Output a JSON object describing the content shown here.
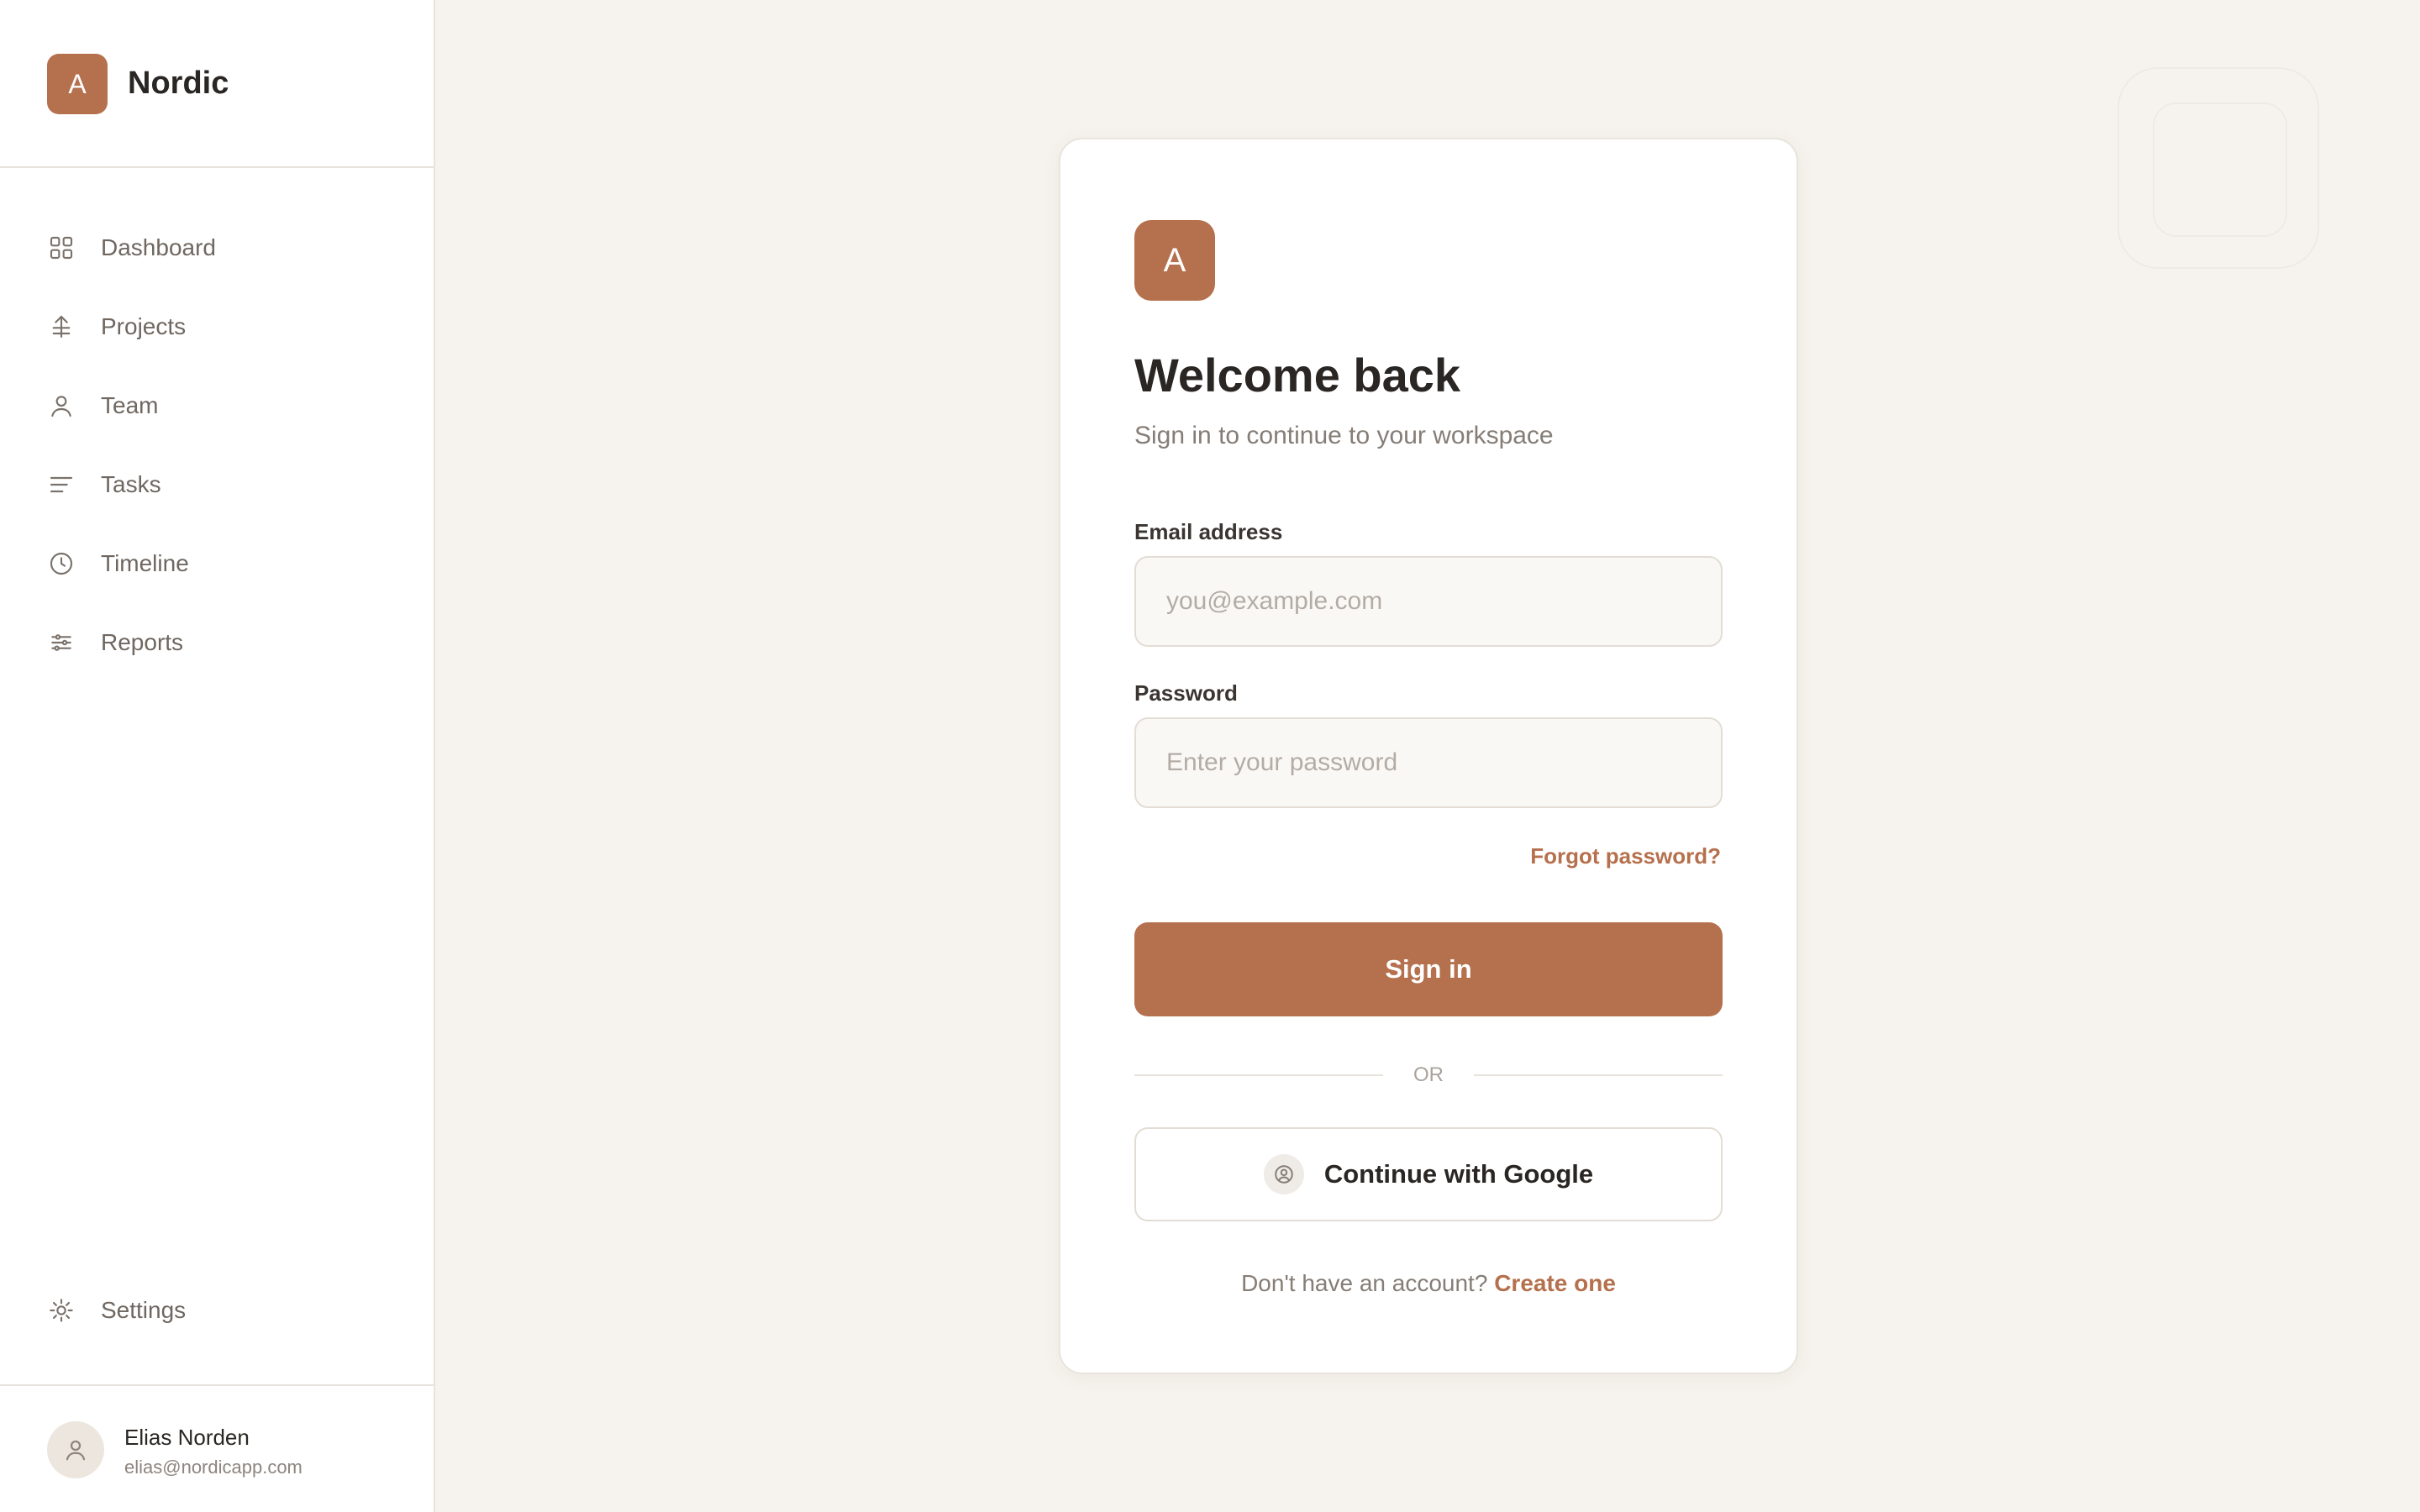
{
  "brand": {
    "logo_letter": "A",
    "name": "Nordic"
  },
  "sidebar": {
    "items": [
      {
        "label": "Dashboard",
        "icon": "grid-icon"
      },
      {
        "label": "Projects",
        "icon": "projects-icon"
      },
      {
        "label": "Team",
        "icon": "user-icon"
      },
      {
        "label": "Tasks",
        "icon": "list-icon"
      },
      {
        "label": "Timeline",
        "icon": "clock-icon"
      },
      {
        "label": "Reports",
        "icon": "sliders-icon"
      }
    ],
    "settings": {
      "label": "Settings",
      "icon": "gear-icon"
    }
  },
  "user": {
    "name": "Elias Norden",
    "email": "elias@nordicapp.com"
  },
  "login": {
    "logo_letter": "A",
    "title": "Welcome back",
    "subtitle": "Sign in to continue to your workspace",
    "email_label": "Email address",
    "email_placeholder": "you@example.com",
    "password_label": "Password",
    "password_placeholder": "Enter your password",
    "forgot_label": "Forgot password?",
    "signin_label": "Sign in",
    "divider_label": "OR",
    "google_label": "Continue with Google",
    "no_account_text": "Don't have an account?",
    "create_label": "Create one"
  },
  "colors": {
    "accent": "#b5704d",
    "background": "#f6f3ee",
    "surface": "#ffffff"
  }
}
